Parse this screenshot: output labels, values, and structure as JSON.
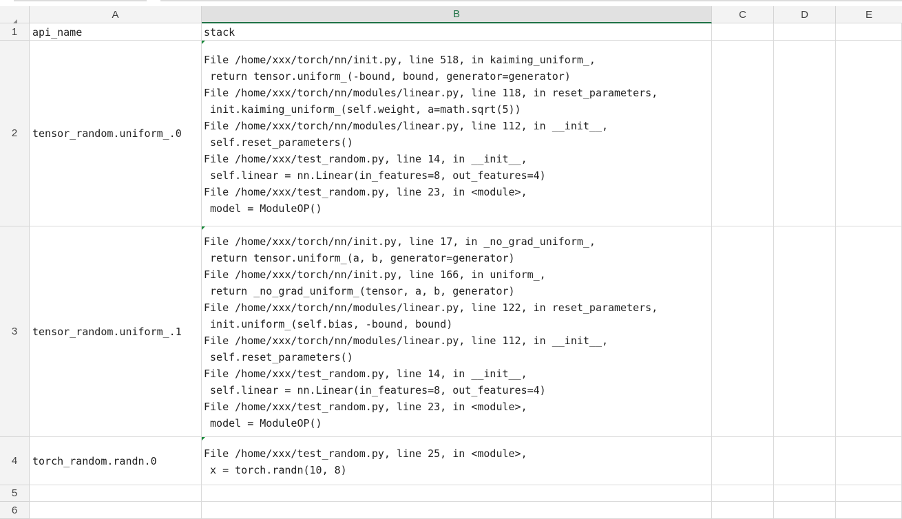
{
  "column_headers": [
    "A",
    "B",
    "C",
    "D",
    "E"
  ],
  "row_numbers": [
    "1",
    "2",
    "3",
    "4",
    "5",
    "6"
  ],
  "active_column": "B",
  "rows": [
    {
      "a": "api_name",
      "b": "stack"
    },
    {
      "a": "tensor_random.uniform_.0",
      "b": "File /home/xxx/torch/nn/init.py, line 518, in kaiming_uniform_,\n return tensor.uniform_(-bound, bound, generator=generator)\nFile /home/xxx/torch/nn/modules/linear.py, line 118, in reset_parameters,\n init.kaiming_uniform_(self.weight, a=math.sqrt(5))\nFile /home/xxx/torch/nn/modules/linear.py, line 112, in __init__,\n self.reset_parameters()\nFile /home/xxx/test_random.py, line 14, in __init__,\n self.linear = nn.Linear(in_features=8, out_features=4)\nFile /home/xxx/test_random.py, line 23, in <module>,\n model = ModuleOP()"
    },
    {
      "a": "tensor_random.uniform_.1",
      "b": "File /home/xxx/torch/nn/init.py, line 17, in _no_grad_uniform_,\n return tensor.uniform_(a, b, generator=generator)\nFile /home/xxx/torch/nn/init.py, line 166, in uniform_,\n return _no_grad_uniform_(tensor, a, b, generator)\nFile /home/xxx/torch/nn/modules/linear.py, line 122, in reset_parameters,\n init.uniform_(self.bias, -bound, bound)\nFile /home/xxx/torch/nn/modules/linear.py, line 112, in __init__,\n self.reset_parameters()\nFile /home/xxx/test_random.py, line 14, in __init__,\n self.linear = nn.Linear(in_features=8, out_features=4)\nFile /home/xxx/test_random.py, line 23, in <module>,\n model = ModuleOP()"
    },
    {
      "a": "torch_random.randn.0",
      "b": "File /home/xxx/test_random.py, line 25, in <module>,\n x = torch.randn(10, 8)"
    },
    {
      "a": "",
      "b": ""
    },
    {
      "a": "",
      "b": ""
    }
  ],
  "colors": {
    "active_header_text": "#1e7145",
    "comment_marker": "#1a8a3b",
    "gridline": "#dadada"
  }
}
